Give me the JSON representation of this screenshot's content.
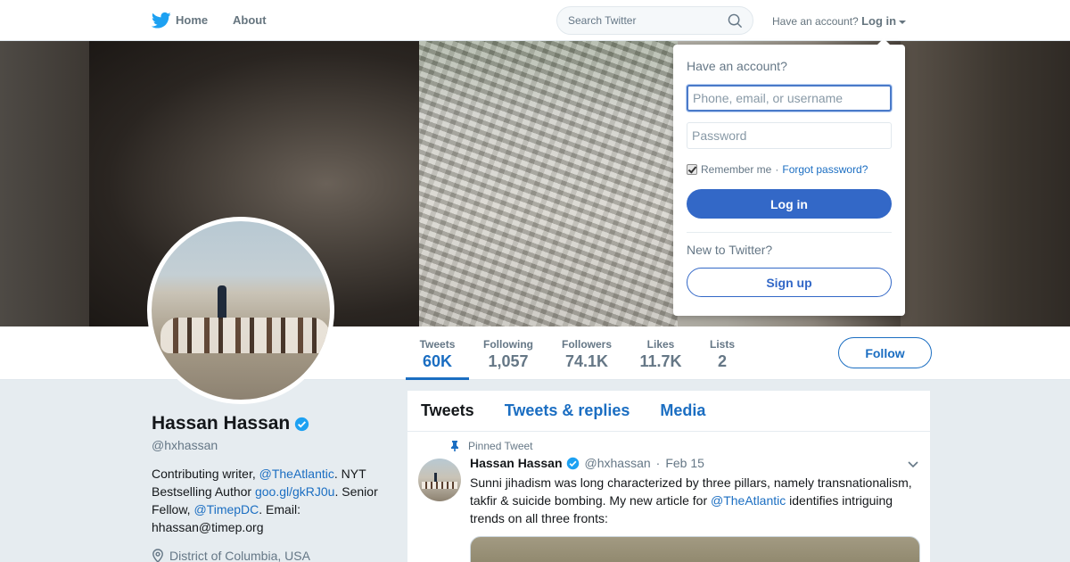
{
  "topbar": {
    "home_label": "Home",
    "about_label": "About",
    "search_placeholder": "Search Twitter",
    "account_prompt": "Have an account?",
    "login_label": "Log in"
  },
  "colors": {
    "brand_blue": "#1da1f2",
    "link_blue": "#1b6ec2",
    "button_blue": "#3368c7"
  },
  "icons": {
    "logo": "twitter-bird-icon",
    "search": "search-icon",
    "verified": "verified-badge-icon",
    "pin": "pin-icon",
    "location": "location-pin-icon",
    "caret": "chevron-down-icon"
  },
  "stats": [
    {
      "label": "Tweets",
      "value": "60K"
    },
    {
      "label": "Following",
      "value": "1,057"
    },
    {
      "label": "Followers",
      "value": "74.1K"
    },
    {
      "label": "Likes",
      "value": "11.7K"
    },
    {
      "label": "Lists",
      "value": "2"
    }
  ],
  "follow_label": "Follow",
  "profile": {
    "name": "Hassan Hassan",
    "handle": "@hxhassan",
    "bio": {
      "t1": "Contributing writer, ",
      "link1": "@TheAtlantic",
      "t2": ". NYT Bestselling Author ",
      "link2": "goo.gl/gkRJ0u",
      "t3": ". Senior Fellow, ",
      "link3": "@TimepDC",
      "t4": ". Email: hhassan@timep.org"
    },
    "location": "District of Columbia, USA"
  },
  "timeline": {
    "tabs": [
      "Tweets",
      "Tweets & replies",
      "Media"
    ],
    "pinned_label": "Pinned Tweet",
    "tweet": {
      "name": "Hassan Hassan",
      "handle": "@hxhassan",
      "separator": "·",
      "date": "Feb 15",
      "text1": "Sunni jihadism was long characterized by three pillars, namely transnationalism, takfir & suicide bombing. My new article for ",
      "link": "@TheAtlantic",
      "text2": " identifies intriguing trends on all three fronts:"
    }
  },
  "login_dropdown": {
    "title": "Have an account?",
    "username_placeholder": "Phone, email, or username",
    "password_placeholder": "Password",
    "remember_label": "Remember me",
    "separator": "·",
    "forgot_label": "Forgot password?",
    "login_button": "Log in",
    "new_prompt": "New to Twitter?",
    "signup_button": "Sign up"
  }
}
